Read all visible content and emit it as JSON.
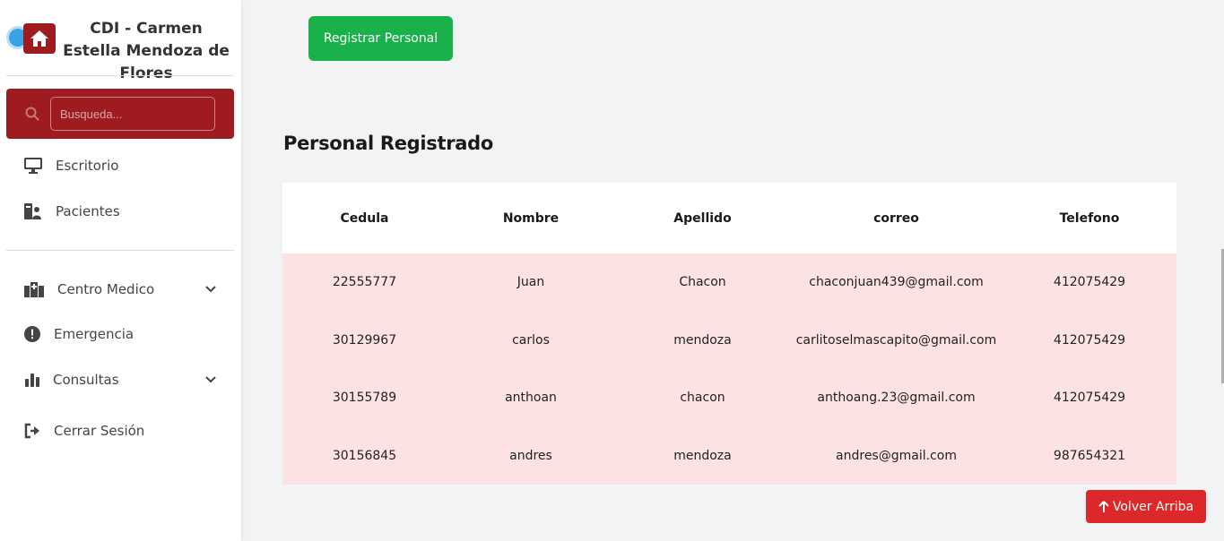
{
  "brand": {
    "title": "CDI - Carmen Estella Mendoza de Flores"
  },
  "search": {
    "placeholder": "Busqueda..."
  },
  "sidebar": {
    "items": [
      {
        "label": "Escritorio",
        "icon": "monitor-icon"
      },
      {
        "label": "Pacientes",
        "icon": "patient-id-icon"
      },
      {
        "label": "Centro Medico",
        "icon": "hospital-icon",
        "has_submenu": true
      },
      {
        "label": "Emergencia",
        "icon": "exclamation-circle-icon"
      },
      {
        "label": "Consultas",
        "icon": "bar-chart-icon",
        "has_submenu": true
      },
      {
        "label": "Cerrar Sesión",
        "icon": "logout-icon"
      }
    ]
  },
  "main": {
    "register_button": "Registrar Personal",
    "section_title": "Personal Registrado",
    "table": {
      "columns": [
        "Cedula",
        "Nombre",
        "Apellido",
        "correo",
        "Telefono"
      ],
      "rows": [
        [
          "22555777",
          "Juan",
          "Chacon",
          "chaconjuan439@gmail.com",
          "412075429"
        ],
        [
          "30129967",
          "carlos",
          "mendoza",
          "carlitoselmascapito@gmail.com",
          "412075429"
        ],
        [
          "30155789",
          "anthoan",
          "chacon",
          "anthoang.23@gmail.com",
          "412075429"
        ],
        [
          "30156845",
          "andres",
          "mendoza",
          "andres@gmail.com",
          "987654321"
        ]
      ]
    },
    "back_to_top": "Volver Arriba"
  },
  "colors": {
    "brand_red": "#9e1c1f",
    "register_green": "#19b24a",
    "row_pink": "#fde2e3",
    "back_top_red": "#dc2828"
  }
}
